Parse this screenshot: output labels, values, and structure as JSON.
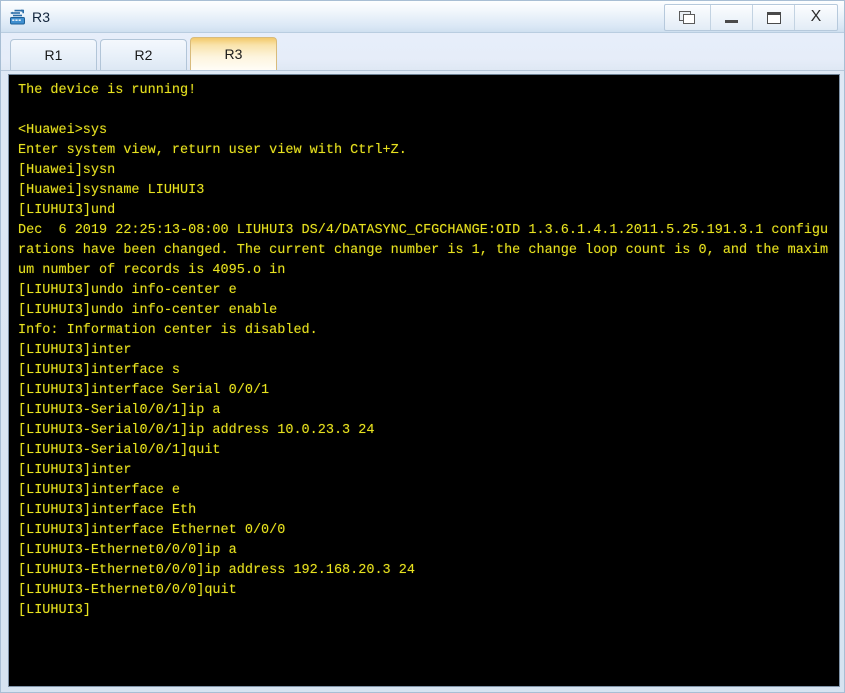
{
  "window": {
    "title": "R3",
    "icon": "router-icon",
    "controls": [
      {
        "name": "restore-windows-button",
        "icon": "restore-icon",
        "label": ""
      },
      {
        "name": "minimize-button",
        "icon": "minimize-icon",
        "label": ""
      },
      {
        "name": "maximize-button",
        "icon": "maximize-icon",
        "label": ""
      },
      {
        "name": "close-button",
        "icon": "close-icon",
        "label": "X"
      }
    ]
  },
  "tabs": [
    {
      "label": "R1",
      "active": false
    },
    {
      "label": "R2",
      "active": false
    },
    {
      "label": "R3",
      "active": true
    }
  ],
  "terminal": {
    "foreground": "#e8e21f",
    "background": "#000000",
    "content": "The device is running!\n\n<Huawei>sys\nEnter system view, return user view with Ctrl+Z.\n[Huawei]sysn\n[Huawei]sysname LIUHUI3\n[LIUHUI3]und\nDec  6 2019 22:25:13-08:00 LIUHUI3 DS/4/DATASYNC_CFGCHANGE:OID 1.3.6.1.4.1.2011.5.25.191.3.1 configurations have been changed. The current change number is 1, the change loop count is 0, and the maximum number of records is 4095.o in\n[LIUHUI3]undo info-center e\n[LIUHUI3]undo info-center enable\nInfo: Information center is disabled.\n[LIUHUI3]inter\n[LIUHUI3]interface s\n[LIUHUI3]interface Serial 0/0/1\n[LIUHUI3-Serial0/0/1]ip a\n[LIUHUI3-Serial0/0/1]ip address 10.0.23.3 24\n[LIUHUI3-Serial0/0/1]quit\n[LIUHUI3]inter\n[LIUHUI3]interface e\n[LIUHUI3]interface Eth\n[LIUHUI3]interface Ethernet 0/0/0\n[LIUHUI3-Ethernet0/0/0]ip a\n[LIUHUI3-Ethernet0/0/0]ip address 192.168.20.3 24\n[LIUHUI3-Ethernet0/0/0]quit\n[LIUHUI3]"
  }
}
